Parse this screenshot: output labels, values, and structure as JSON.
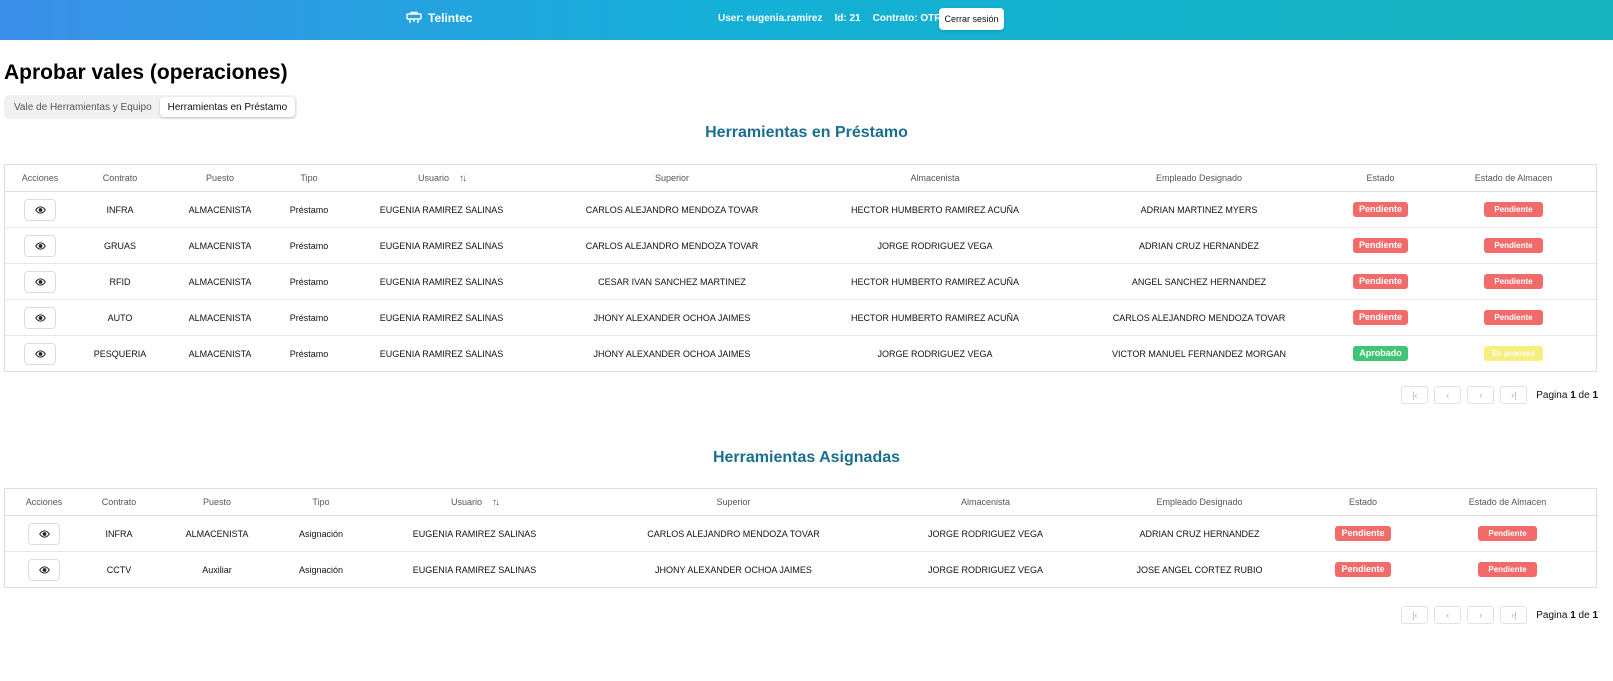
{
  "header": {
    "brand": "Telintec",
    "user_label": "User: eugenia.ramirez",
    "id_label": "Id: 21",
    "contract_label": "Contrato: OTROS",
    "logout_label": "Cerrar sesión",
    "brand_icon": "toolbox-icon"
  },
  "page": {
    "title": "Aprobar vales (operaciones)",
    "tabs": [
      {
        "label": "Vale de Herramientas y Equipo",
        "active": false
      },
      {
        "label": "Herramientas en Préstamo",
        "active": true
      }
    ]
  },
  "colors": {
    "pendiente": "#f26b6b",
    "aprobado": "#3fc575",
    "en_proceso": "#f6ee7e",
    "title": "#1b6f8e"
  },
  "loan_table": {
    "title": "Herramientas en Préstamo",
    "columns": [
      "Acciones",
      "Contrato",
      "Puesto",
      "Tipo",
      "Usuario",
      "Superior",
      "Almacenista",
      "Empleado Designado",
      "Estado",
      "Estado de Almacen"
    ],
    "rows": [
      {
        "contrato": "INFRA",
        "puesto": "ALMACENISTA",
        "tipo": "Préstamo",
        "usuario": "EUGENIA RAMIREZ SALINAS",
        "superior": "CARLOS ALEJANDRO MENDOZA TOVAR",
        "almacenista": "HECTOR HUMBERTO RAMIREZ ACUÑA",
        "empleado": "ADRIAN MARTINEZ MYERS",
        "estado": "Pendiente",
        "estado_almacen": "Pendiente"
      },
      {
        "contrato": "GRUAS",
        "puesto": "ALMACENISTA",
        "tipo": "Préstamo",
        "usuario": "EUGENIA RAMIREZ SALINAS",
        "superior": "CARLOS ALEJANDRO MENDOZA TOVAR",
        "almacenista": "JORGE RODRIGUEZ VEGA",
        "empleado": "ADRIAN CRUZ HERNANDEZ",
        "estado": "Pendiente",
        "estado_almacen": "Pendiente"
      },
      {
        "contrato": "RFID",
        "puesto": "ALMACENISTA",
        "tipo": "Préstamo",
        "usuario": "EUGENIA RAMIREZ SALINAS",
        "superior": "CESAR IVAN SANCHEZ MARTINEZ",
        "almacenista": "HECTOR HUMBERTO RAMIREZ ACUÑA",
        "empleado": "ANGEL SANCHEZ HERNANDEZ",
        "estado": "Pendiente",
        "estado_almacen": "Pendiente"
      },
      {
        "contrato": "AUTO",
        "puesto": "ALMACENISTA",
        "tipo": "Préstamo",
        "usuario": "EUGENIA RAMIREZ SALINAS",
        "superior": "JHONY ALEXANDER OCHOA JAIMES",
        "almacenista": "HECTOR HUMBERTO RAMIREZ ACUÑA",
        "empleado": "CARLOS ALEJANDRO MENDOZA TOVAR",
        "estado": "Pendiente",
        "estado_almacen": "Pendiente"
      },
      {
        "contrato": "PESQUERIA",
        "puesto": "ALMACENISTA",
        "tipo": "Préstamo",
        "usuario": "EUGENIA RAMIREZ SALINAS",
        "superior": "JHONY ALEXANDER OCHOA JAIMES",
        "almacenista": "JORGE RODRIGUEZ VEGA",
        "empleado": "VICTOR MANUEL FERNANDEZ MORGAN",
        "estado": "Aprobado",
        "estado_almacen": "En proceso"
      }
    ],
    "pagination": {
      "prefix": "Pagina",
      "current": "1",
      "sep": "de",
      "total": "1"
    }
  },
  "assigned_table": {
    "title": "Herramientas Asignadas",
    "columns": [
      "Acciones",
      "Contrato",
      "Puesto",
      "Tipo",
      "Usuario",
      "Superior",
      "Almacenista",
      "Empleado Designado",
      "Estado",
      "Estado de Almacen"
    ],
    "rows": [
      {
        "contrato": "INFRA",
        "puesto": "ALMACENISTA",
        "tipo": "Asignación",
        "usuario": "EUGENIA RAMIREZ SALINAS",
        "superior": "CARLOS ALEJANDRO MENDOZA TOVAR",
        "almacenista": "JORGE RODRIGUEZ VEGA",
        "empleado": "ADRIAN CRUZ HERNANDEZ",
        "estado": "Pendiente",
        "estado_almacen": "Pendiente"
      },
      {
        "contrato": "CCTV",
        "puesto": "Auxiliar",
        "tipo": "Asignación",
        "usuario": "EUGENIA RAMIREZ SALINAS",
        "superior": "JHONY ALEXANDER OCHOA JAIMES",
        "almacenista": "JORGE RODRIGUEZ VEGA",
        "empleado": "JOSE ANGEL CORTEZ RUBIO",
        "estado": "Pendiente",
        "estado_almacen": "Pendiente"
      }
    ],
    "pagination": {
      "prefix": "Pagina",
      "current": "1",
      "sep": "de",
      "total": "1"
    }
  }
}
